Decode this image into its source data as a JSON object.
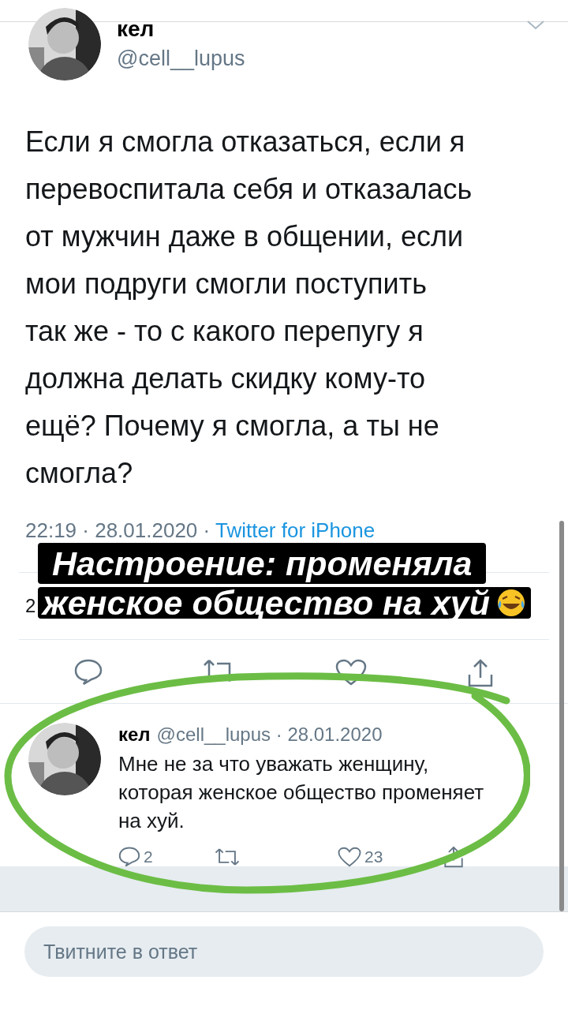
{
  "tweet": {
    "name": "кел",
    "handle": "@cell__lupus",
    "text": "Если я смогла отказаться, если я перевоспитала себя и отказалась от мужчин даже в общении, если мои подруги смогли поступить так же - то с какого перепугу я должна делать скидку кому-то ещё? Почему я смогла, а ты не смогла?",
    "timestamp": "22:19 · 28.01.2020 · ",
    "source": "Twitter for iPhone",
    "stats_visible": "2"
  },
  "reply": {
    "name": "кел",
    "handle": "@cell__lupus · 28.01.2020",
    "text": "Мне не за что уважать женщину, которая женское общество променяет на хуй.",
    "replies": "2",
    "likes": "23"
  },
  "reply_field": {
    "placeholder": "Твитните в ответ"
  },
  "story_caption": {
    "lines": [
      "Настроение: променяла",
      "женское общество на хуй"
    ]
  }
}
